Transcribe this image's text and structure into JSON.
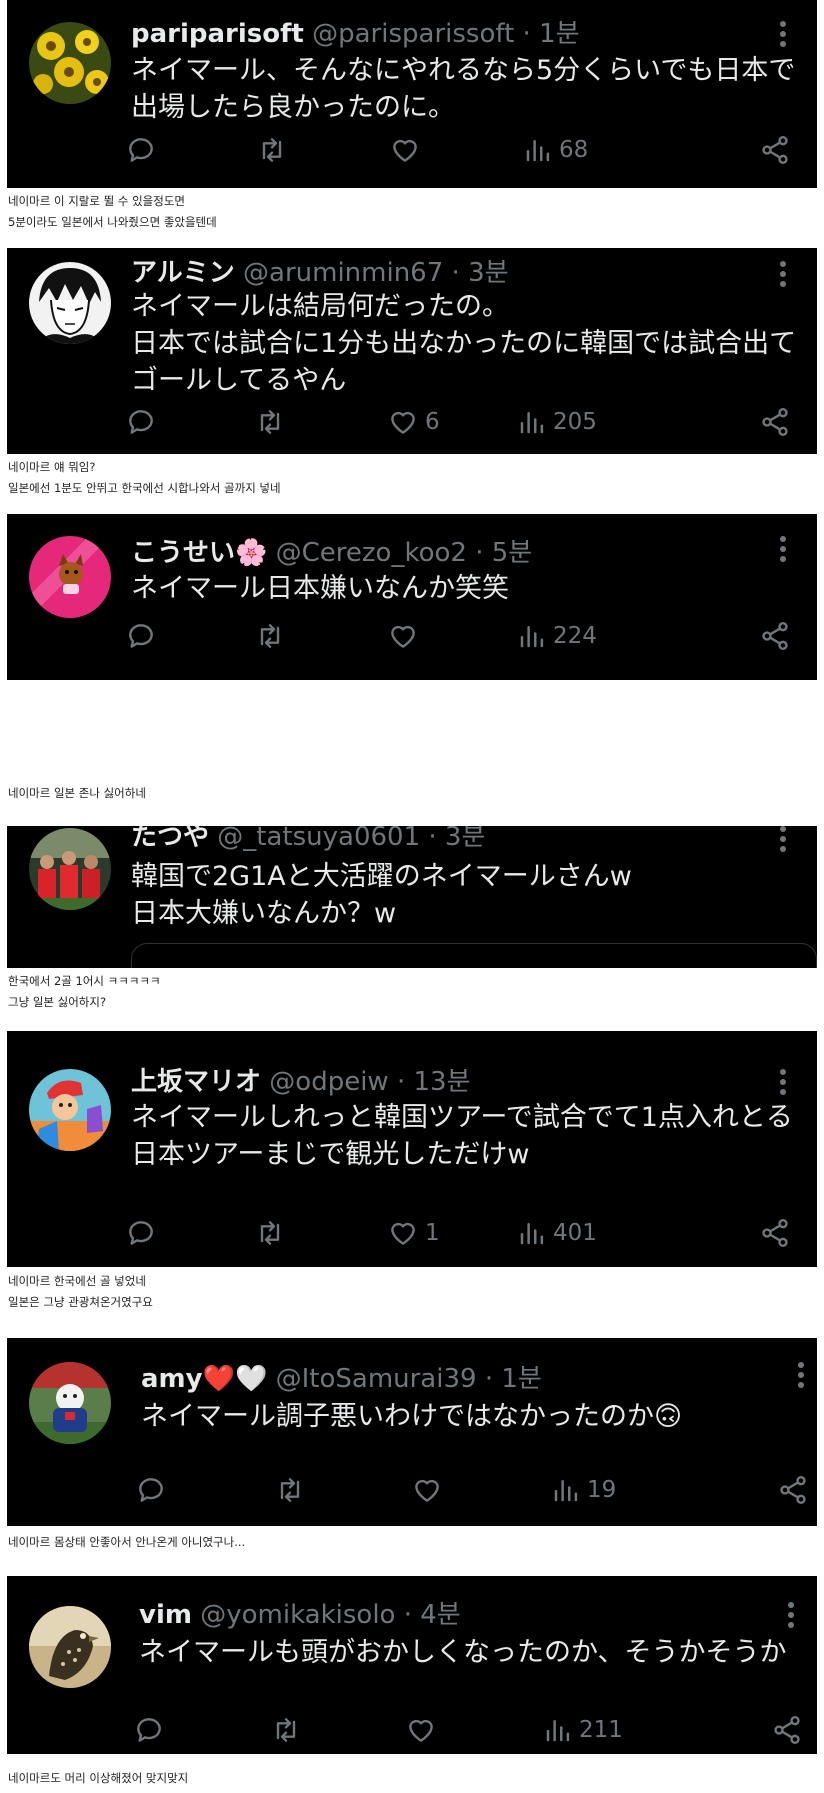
{
  "colors": {
    "background": "#000000",
    "primary_text": "#e7e9ea",
    "secondary_text": "#71767b",
    "caption_text": "#222222"
  },
  "icons": [
    "reply-icon",
    "retweet-icon",
    "like-icon",
    "views-icon",
    "share-icon",
    "more-icon"
  ],
  "posts": [
    {
      "name": "pariparisoft",
      "handle": "@parisparissoft",
      "time": "1분",
      "body": "ネイマール、そんなにやれるなら5分くらいでも日本で\n出場したら良かったのに。",
      "likes": "",
      "views": "68",
      "caption": "네이마르 이 지랄로 뛸 수 있을정도면\n5분이라도 일본에서 나와줬으면 좋았을텐데"
    },
    {
      "name": "アルミン",
      "handle": "@aruminmin67",
      "time": "3분",
      "body": "ネイマールは結局何だったの。\n日本では試合に1分も出なかったのに韓国では試合出て\nゴールしてるやん",
      "likes": "6",
      "views": "205",
      "caption": "네이마르 얘 뭐임?\n일본에선 1분도 안뛰고 한국에선 시합나와서 골까지 넣네"
    },
    {
      "name": "こうせい🌸",
      "handle": "@Cerezo_koo2",
      "time": "5분",
      "body": "ネイマール日本嫌いなんか笑笑",
      "likes": "",
      "views": "224",
      "caption": "네이마르 일본 존나 싫어하네"
    },
    {
      "name": "たつや",
      "handle": "@_tatsuya0601",
      "time": "3분",
      "body": "韓国で2G1Aと大活躍のネイマールさんw\n日本大嫌いなんか？w",
      "caption": "한국에서 2골 1어시 ㅋㅋㅋㅋㅋ\n그냥 일본 싫어하지?"
    },
    {
      "name": "上坂マリオ",
      "handle": "@odpeiw",
      "time": "13분",
      "body": "ネイマールしれっと韓国ツアーで試合でて1点入れとる\n日本ツアーまじで観光しただけw",
      "likes": "1",
      "views": "401",
      "caption": "네이마르 한국에선 골 넣었네\n일본은 그냥 관광쳐온거였구요"
    },
    {
      "name": "amy❤️🤍",
      "handle": "@ItoSamurai39",
      "time": "1분",
      "body": "ネイマール調子悪いわけではなかったのか🙃",
      "likes": "",
      "views": "19",
      "caption": "네이마르  몸상태 안좋아서 안나온게 아니였구나..."
    },
    {
      "name": "vim",
      "handle": "@yomikakisolo",
      "time": "4분",
      "body": "ネイマールも頭がおかしくなったのか、そうかそうか",
      "likes": "",
      "views": "211",
      "caption": "네이마르도 머리 이상해졌어 맞지맞지"
    }
  ]
}
